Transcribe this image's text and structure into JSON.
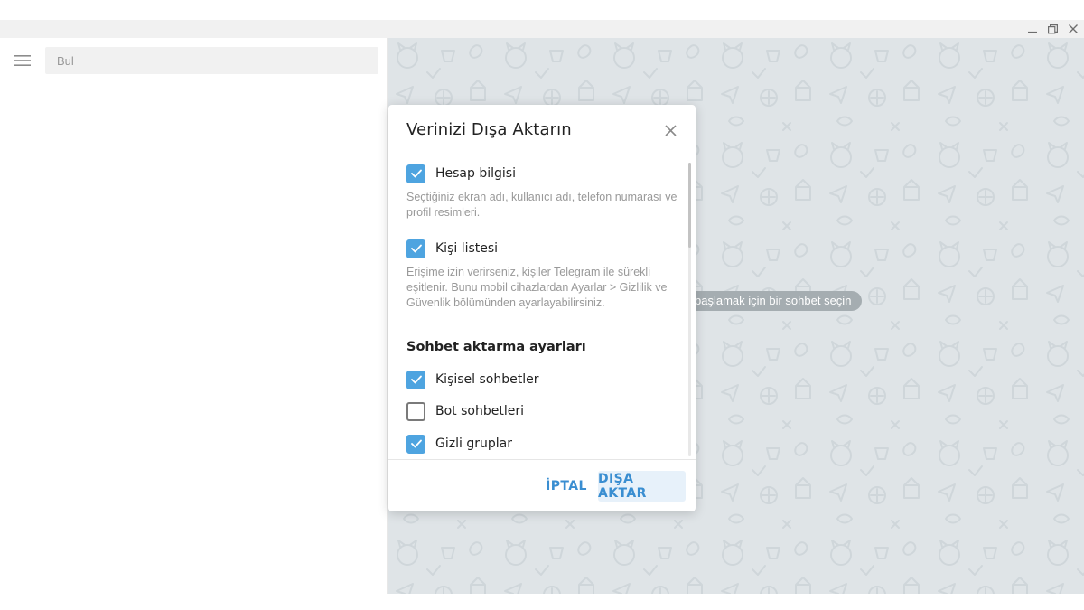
{
  "search": {
    "placeholder": "Bul"
  },
  "chat_area": {
    "empty_hint": "başlamak için bir sohbet seçin"
  },
  "dialog": {
    "title": "Verinizi Dışa Aktarın",
    "items": [
      {
        "label": "Hesap bilgisi",
        "checked": true,
        "description": "Seçtiğiniz ekran adı, kullanıcı adı, telefon numarası ve profil resimleri."
      },
      {
        "label": "Kişi listesi",
        "checked": true,
        "description": "Erişime izin verirseniz, kişiler Telegram ile sürekli eşitlenir. Bunu mobil cihazlardan Ayarlar > Gizlilik ve Güvenlik bölümünden ayarlayabilirsiniz."
      }
    ],
    "section_title": "Sohbet aktarma ayarları",
    "chat_options": [
      {
        "label": "Kişisel sohbetler",
        "checked": true
      },
      {
        "label": "Bot sohbetleri",
        "checked": false
      },
      {
        "label": "Gizli gruplar",
        "checked": true
      }
    ],
    "cancel_label": "İPTAL",
    "export_label": "DIŞA AKTAR"
  },
  "colors": {
    "accent": "#4ea4e0",
    "button_text": "#3a8ed1",
    "chat_bg": "#dfe4e7"
  }
}
